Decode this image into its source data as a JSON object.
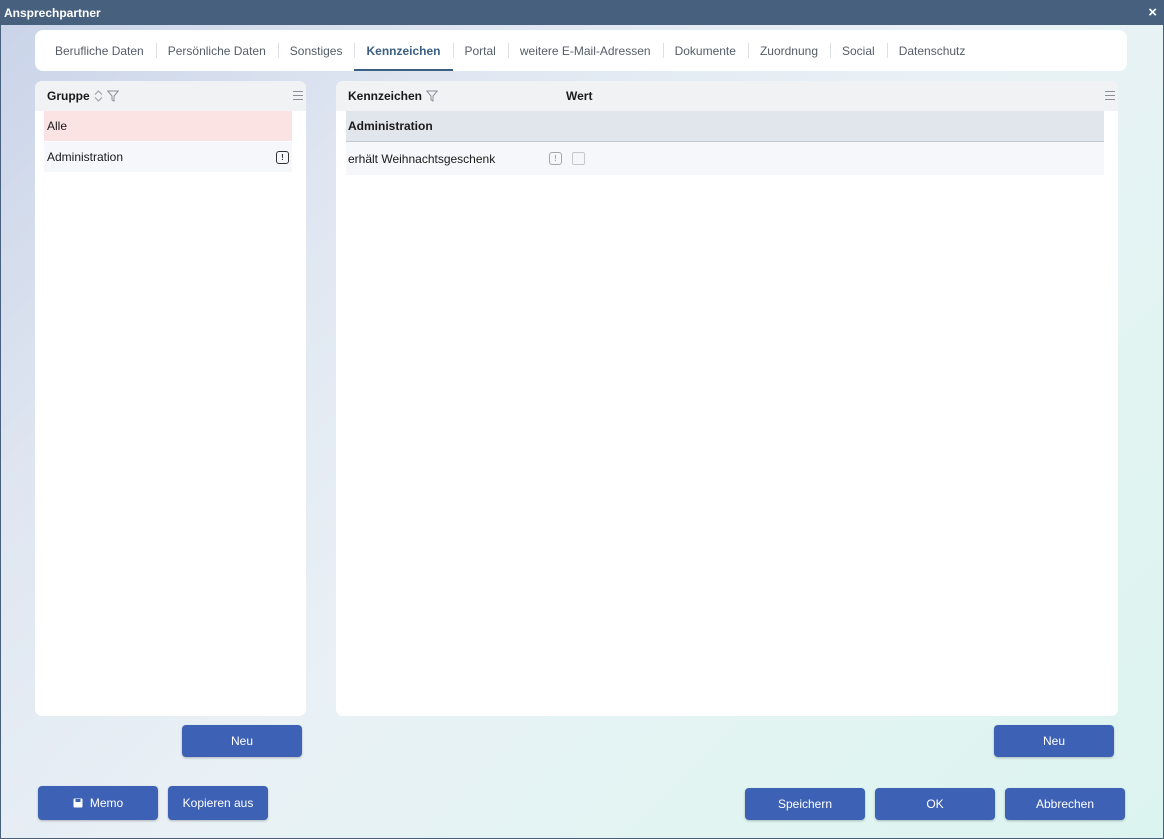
{
  "window": {
    "title": "Ansprechpartner",
    "close_glyph": "×"
  },
  "tabs": [
    {
      "label": "Berufliche Daten",
      "active": false
    },
    {
      "label": "Persönliche Daten",
      "active": false
    },
    {
      "label": "Sonstiges",
      "active": false
    },
    {
      "label": "Kennzeichen",
      "active": true
    },
    {
      "label": "Portal",
      "active": false
    },
    {
      "label": "weitere E-Mail-Adressen",
      "active": false
    },
    {
      "label": "Dokumente",
      "active": false
    },
    {
      "label": "Zuordnung",
      "active": false
    },
    {
      "label": "Social",
      "active": false
    },
    {
      "label": "Datenschutz",
      "active": false
    }
  ],
  "group_panel": {
    "header": "Gruppe",
    "items": [
      {
        "label": "Alle",
        "selected": true
      },
      {
        "label": "Administration",
        "selected": false,
        "badge": "!"
      }
    ],
    "new_button": "Neu"
  },
  "flag_panel": {
    "columns": {
      "flag": "Kennzeichen",
      "value": "Wert"
    },
    "groups": [
      {
        "name": "Administration",
        "rows": [
          {
            "label": "erhält Weihnachtsgeschenk",
            "info": "!",
            "checked": false
          }
        ]
      }
    ],
    "new_button": "Neu"
  },
  "footer": {
    "memo": "Memo",
    "copy_from": "Kopieren aus",
    "save": "Speichern",
    "ok": "OK",
    "cancel": "Abbrechen"
  },
  "colors": {
    "titlebar": "#47607e",
    "accent_button": "#3d61b5",
    "active_tab": "#3a5f83",
    "selected_row": "#fbe3e3"
  }
}
